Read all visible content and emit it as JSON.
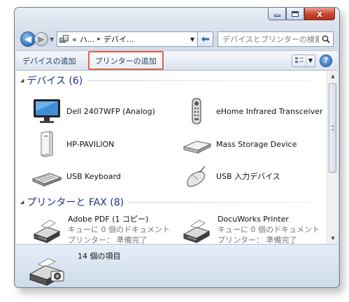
{
  "window": {
    "close_glyph": "x"
  },
  "nav": {
    "back_glyph": "◀",
    "forward_glyph": "▶"
  },
  "address": {
    "prefix": "«",
    "crumbs": [
      "ハ...",
      "デバイ..."
    ],
    "separator": "▸"
  },
  "search": {
    "placeholder": "デバイスとプリンターの検索"
  },
  "commands": {
    "add_device": "デバイスの追加",
    "add_printer": "プリンターの追加",
    "help": "?"
  },
  "groups": {
    "devices": {
      "title": "デバイス (6)",
      "items": [
        {
          "label": "Dell 2407WFP (Analog)",
          "icon": "monitor-icon"
        },
        {
          "label": "eHome Infrared Transceiver",
          "icon": "remote-control-icon"
        },
        {
          "label": "HP-PAVILION",
          "icon": "computer-tower-icon"
        },
        {
          "label": "Mass Storage Device",
          "icon": "drive-icon"
        },
        {
          "label": "USB Keyboard",
          "icon": "keyboard-icon"
        },
        {
          "label": "USB 入力デバイス",
          "icon": "mouse-icon"
        }
      ]
    },
    "printers": {
      "title": "プリンターと FAX (8)",
      "items": [
        {
          "name": "Adobe PDF (1 コピー)",
          "queue": "キューに 0 個のドキュメント",
          "status": "プリンター： 準備完了",
          "icon": "printer-icon"
        },
        {
          "name": "DocuWorks Printer",
          "queue": "キューに 0 個のドキュメント",
          "status": "プリンター： 準備完了",
          "icon": "printer-icon"
        }
      ]
    }
  },
  "details": {
    "count": "14 個の項目",
    "icon": "printer-camera-icon"
  },
  "colors": {
    "highlight_border": "#e2604a",
    "group_title": "#1e3287",
    "command_text": "#1e395b"
  }
}
